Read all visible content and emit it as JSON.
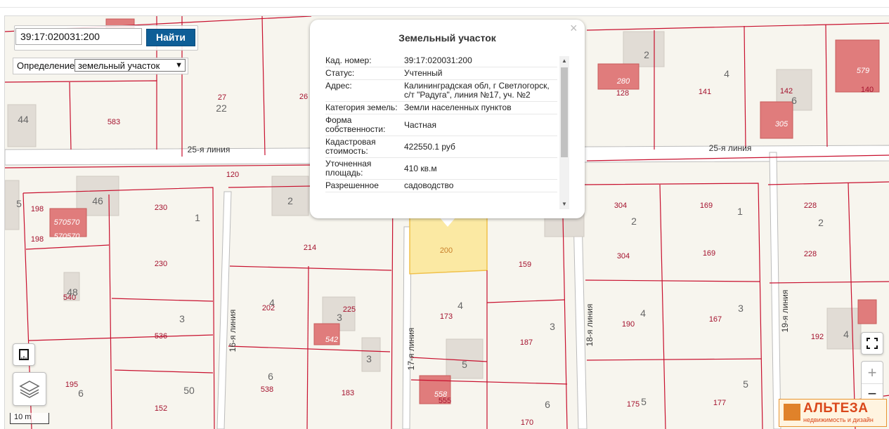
{
  "search": {
    "value": "39:17:020031:200",
    "button_label": "Найти"
  },
  "definition": {
    "label": "Определение:",
    "selected": "земельный участок"
  },
  "popup": {
    "title": "Земельный участок",
    "close_label": "×",
    "rows": [
      {
        "key": "Кад. номер:",
        "value": "39:17:020031:200"
      },
      {
        "key": "Статус:",
        "value": "Учтенный"
      },
      {
        "key": "Адрес:",
        "value": "Калининградская обл, г Светлогорск, с/т \"Радуга\", линия №17, уч. №2"
      },
      {
        "key": "Категория земель:",
        "value": "Земли населенных пунктов"
      },
      {
        "key": "Форма собственности:",
        "value": "Частная"
      },
      {
        "key": "Кадастровая стоимость:",
        "value": "422550.1 руб"
      },
      {
        "key": "Уточненная площадь:",
        "value": "410 кв.м"
      },
      {
        "key": "Разрешенное",
        "value": "садоводство"
      }
    ]
  },
  "map": {
    "street_labels": [
      "25-я линия",
      "25-я линия",
      "16-я линия",
      "17-я линия",
      "18-я линия",
      "19-я линия"
    ],
    "parcel_labels": [
      "583",
      "27",
      "26",
      "280",
      "128",
      "141",
      "142",
      "579",
      "140",
      "305",
      "120",
      "198",
      "570570",
      "570570",
      "198",
      "230",
      "214",
      "200",
      "304",
      "169",
      "228",
      "230",
      "159",
      "304",
      "169",
      "228",
      "540",
      "202",
      "225",
      "173",
      "190",
      "167",
      "192",
      "536",
      "542",
      "187",
      "195",
      "538",
      "183",
      "555",
      "175",
      "177",
      "152",
      "170"
    ],
    "building_labels": [
      "44",
      "22",
      "2",
      "4",
      "6",
      "46",
      "2",
      "1",
      "2",
      "1",
      "2",
      "48",
      "4",
      "3",
      "4",
      "3",
      "4",
      "3",
      "3",
      "4",
      "3",
      "5",
      "6",
      "6",
      "50",
      "5",
      "5",
      "6",
      "5",
      "558"
    ],
    "selected_parcel": "200",
    "scale_label": "10 m"
  },
  "controls": {
    "zoom_in": "+",
    "zoom_out": "−"
  },
  "logo": {
    "name": "АЛЬТЕЗА",
    "tagline": "недвижимость и дизайн"
  },
  "colors": {
    "parcel_line": "#c8102e",
    "building": "#e1dcd5",
    "building_registered": "#e07c7c",
    "selected_fill": "#fbe9a3",
    "search_button": "#0e5e97",
    "map_bg": "#f7f5ee"
  }
}
